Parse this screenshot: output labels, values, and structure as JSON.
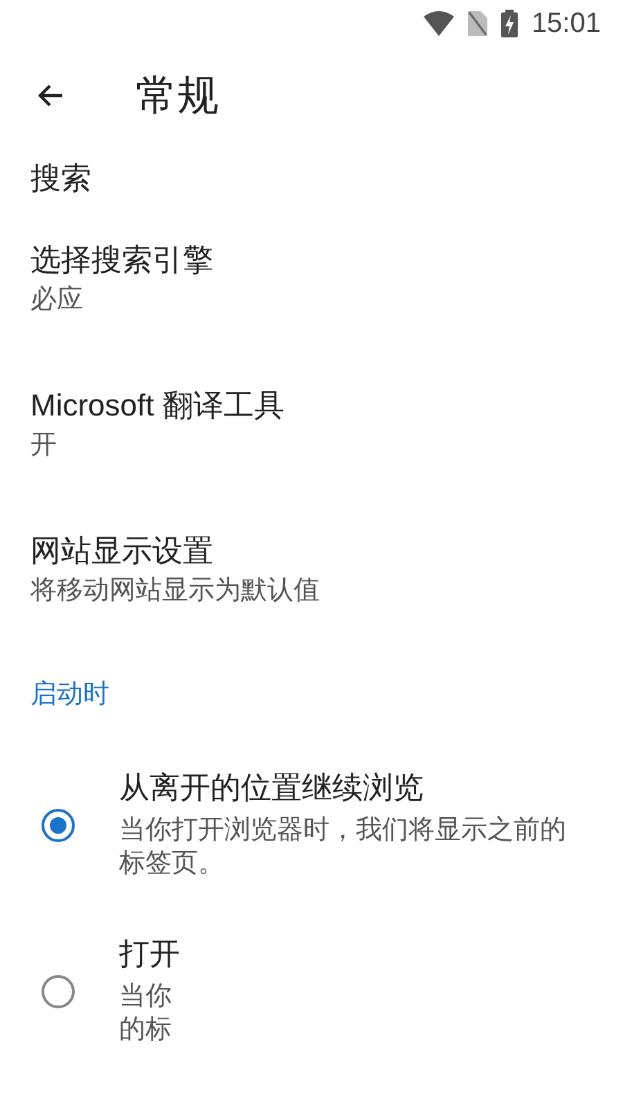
{
  "status_bar": {
    "time": "15:01"
  },
  "header": {
    "title": "常规"
  },
  "sections": [
    {
      "kind": "heading",
      "title": "搜索"
    },
    {
      "kind": "item",
      "title": "选择搜索引擎",
      "value": "必应"
    },
    {
      "kind": "item",
      "title": "Microsoft 翻译工具",
      "value": "开"
    },
    {
      "kind": "item",
      "title": "网站显示设置",
      "value": "将移动网站显示为默认值"
    }
  ],
  "startup": {
    "title": "启动时",
    "options": [
      {
        "title": "从离开的位置继续浏览",
        "description": "当你打开浏览器时，我们将显示之前的标签页。",
        "selected": true
      },
      {
        "title": "打开",
        "description_lines": [
          "当你",
          "的标"
        ],
        "selected": false
      }
    ]
  }
}
